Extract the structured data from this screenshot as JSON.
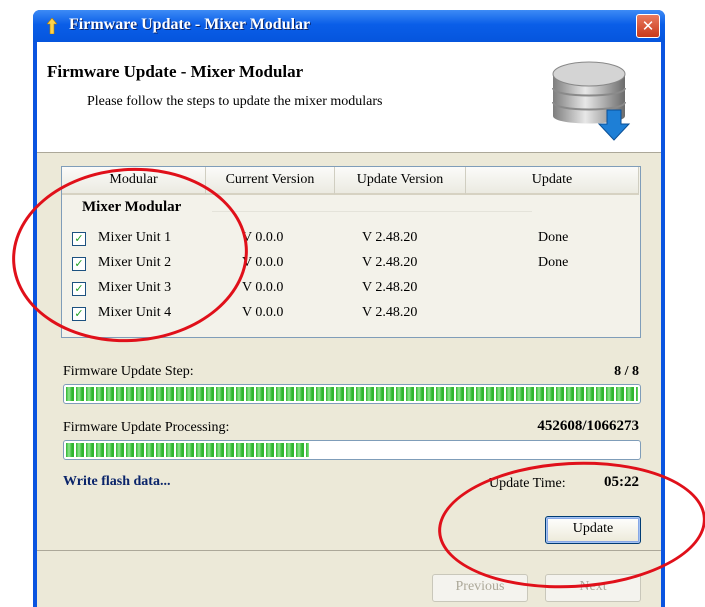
{
  "window": {
    "title": "Firmware Update - Mixer Modular",
    "close_symbol": "✕"
  },
  "header": {
    "title": "Firmware Update - Mixer Modular",
    "subtitle": "Please follow the steps to update the mixer modulars",
    "icon": "database-download-icon"
  },
  "table": {
    "columns": [
      "Modular",
      "Current Version",
      "Update Version",
      "Update"
    ],
    "group": "Mixer Modular",
    "rows": [
      {
        "name": "Mixer Unit 1",
        "current": "V 0.0.0",
        "update": "V 2.48.20",
        "status": "Done",
        "checked": true
      },
      {
        "name": "Mixer Unit 2",
        "current": "V 0.0.0",
        "update": "V 2.48.20",
        "status": "Done",
        "checked": true
      },
      {
        "name": "Mixer Unit 3",
        "current": "V 0.0.0",
        "update": "V 2.48.20",
        "status": "",
        "checked": true
      },
      {
        "name": "Mixer Unit 4",
        "current": "V 0.0.0",
        "update": "V 2.48.20",
        "status": "",
        "checked": true
      }
    ]
  },
  "progress": {
    "step_label": "Firmware Update Step:",
    "step_value": "8 / 8",
    "step_fraction": 1.0,
    "processing_label": "Firmware Update Processing:",
    "processing_value": "452608/1066273",
    "processing_fraction": 0.424
  },
  "status": {
    "message": "Write flash data...",
    "time_label": "Update Time:",
    "time_value": "05:22"
  },
  "buttons": {
    "update": "Update",
    "previous": "Previous",
    "next": "Next"
  },
  "colors": {
    "titlebar": "#0a5ee8",
    "progress": "#2fb62f",
    "annotation": "#e0101a",
    "status_text": "#0a246a"
  }
}
